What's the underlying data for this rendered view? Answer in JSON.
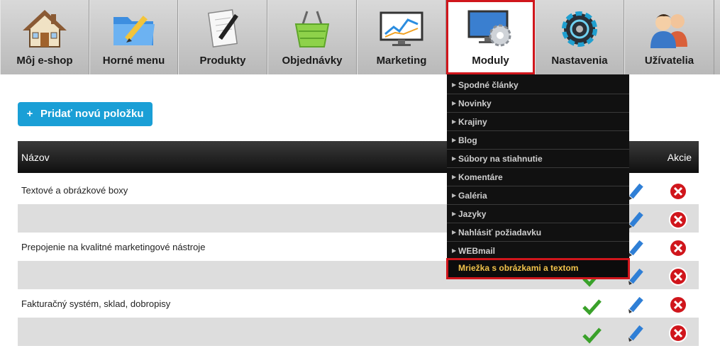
{
  "nav": {
    "items": [
      {
        "label": "Môj e-shop",
        "icon": "home-icon"
      },
      {
        "label": "Horné menu",
        "icon": "folder-pencil-icon"
      },
      {
        "label": "Produkty",
        "icon": "notepad-pen-icon"
      },
      {
        "label": "Objednávky",
        "icon": "basket-icon"
      },
      {
        "label": "Marketing",
        "icon": "chart-monitor-icon"
      },
      {
        "label": "Moduly",
        "icon": "monitor-gear-icon",
        "active": true
      },
      {
        "label": "Nastavenia",
        "icon": "gear-icon"
      },
      {
        "label": "Užívatelia",
        "icon": "users-icon"
      }
    ]
  },
  "toolbar": {
    "add_label": "Pridať novú položku",
    "add_symbol": "+"
  },
  "table": {
    "headers": {
      "name": "Názov",
      "actions": "Akcie"
    },
    "rows": [
      {
        "name": "Textové a obrázkové boxy"
      },
      {
        "name": ""
      },
      {
        "name": "Prepojenie na kvalitné marketingové nástroje"
      },
      {
        "name": ""
      },
      {
        "name": "Fakturačný systém, sklad, dobropisy"
      },
      {
        "name": ""
      }
    ]
  },
  "dropdown": {
    "items": [
      {
        "label": "Spodné články"
      },
      {
        "label": "Novinky"
      },
      {
        "label": "Krajiny"
      },
      {
        "label": "Blog"
      },
      {
        "label": "Súbory na stiahnutie"
      },
      {
        "label": "Komentáre"
      },
      {
        "label": "Galéria"
      },
      {
        "label": "Jazyky"
      },
      {
        "label": "Nahlásiť požiadavku"
      },
      {
        "label": "WEBmail"
      },
      {
        "label": "Mriežka s obrázkami a textom",
        "highlighted": true
      }
    ]
  },
  "colors": {
    "accent_blue": "#1a9fd6",
    "highlight_red": "#d0161c",
    "highlight_text": "#f0c24a",
    "check_green": "#3aa12a",
    "delete_red": "#d0161c"
  }
}
